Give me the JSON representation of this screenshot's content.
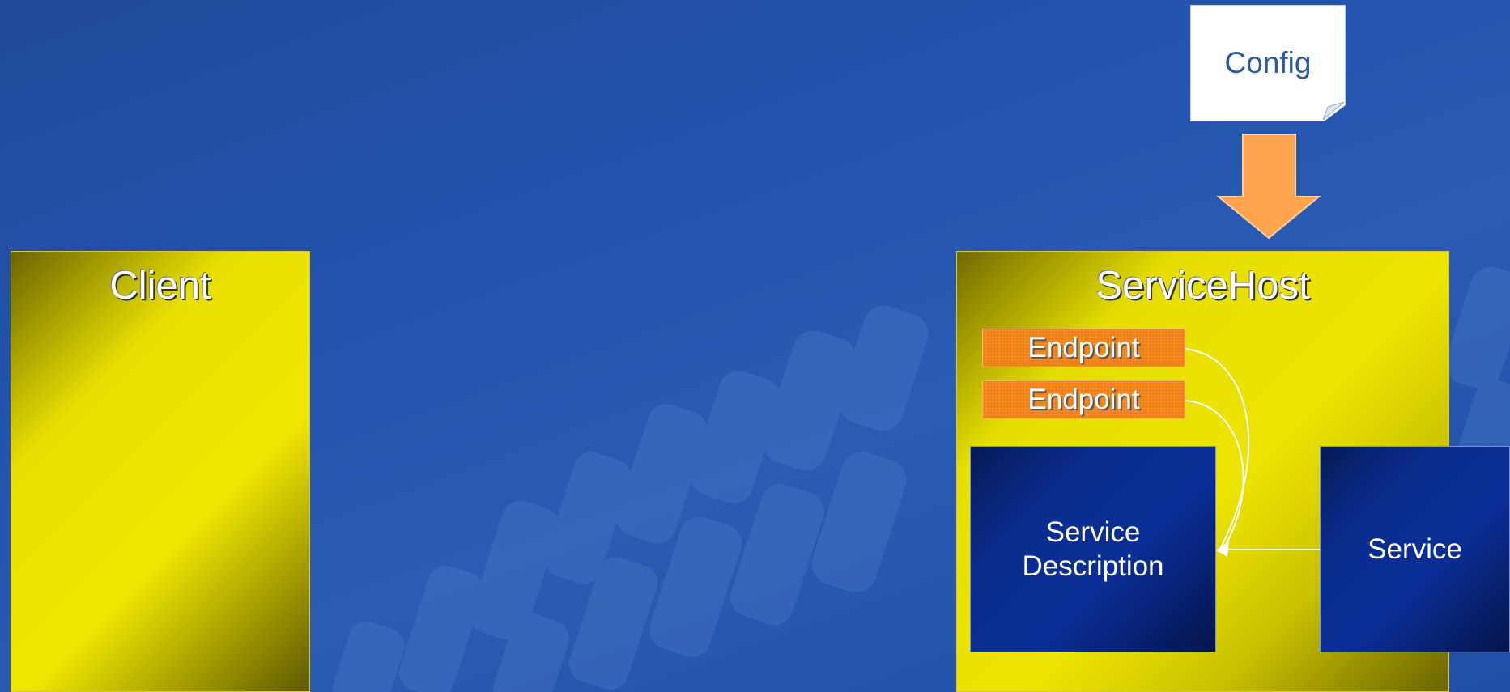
{
  "client": {
    "title": "Client"
  },
  "service_host": {
    "title": "ServiceHost",
    "endpoints": [
      {
        "label": "Endpoint"
      },
      {
        "label": "Endpoint"
      }
    ],
    "service_description": {
      "label": "Service\nDescription"
    }
  },
  "service": {
    "label": "Service"
  },
  "config": {
    "label": "Config"
  },
  "colors": {
    "background": "#2354ae",
    "yellow_box": "#efe600",
    "endpoint": "#f07f10",
    "blue_box": "#0a2e96",
    "config_arrow": "#ff9f45"
  }
}
